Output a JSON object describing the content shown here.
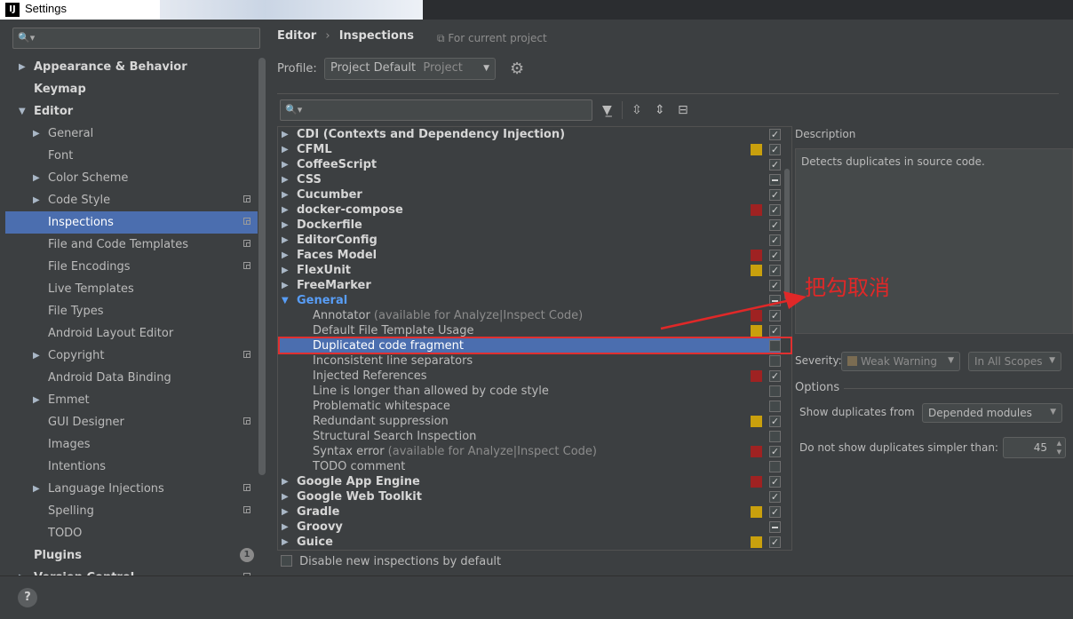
{
  "window": {
    "title": "Settings",
    "app_icon": "IJ"
  },
  "left": {
    "items": [
      {
        "label": "Appearance & Behavior",
        "indent": 0,
        "arrow": "right",
        "bold": true,
        "proj": false
      },
      {
        "label": "Keymap",
        "indent": 0,
        "arrow": "",
        "bold": true,
        "proj": false
      },
      {
        "label": "Editor",
        "indent": 0,
        "arrow": "down",
        "bold": true,
        "proj": false
      },
      {
        "label": "General",
        "indent": 1,
        "arrow": "right",
        "bold": false,
        "proj": false
      },
      {
        "label": "Font",
        "indent": 1,
        "arrow": "",
        "bold": false,
        "proj": false
      },
      {
        "label": "Color Scheme",
        "indent": 1,
        "arrow": "right",
        "bold": false,
        "proj": false
      },
      {
        "label": "Code Style",
        "indent": 1,
        "arrow": "right",
        "bold": false,
        "proj": true
      },
      {
        "label": "Inspections",
        "indent": 1,
        "arrow": "",
        "bold": false,
        "proj": true,
        "selected": true
      },
      {
        "label": "File and Code Templates",
        "indent": 1,
        "arrow": "",
        "bold": false,
        "proj": true
      },
      {
        "label": "File Encodings",
        "indent": 1,
        "arrow": "",
        "bold": false,
        "proj": true
      },
      {
        "label": "Live Templates",
        "indent": 1,
        "arrow": "",
        "bold": false,
        "proj": false
      },
      {
        "label": "File Types",
        "indent": 1,
        "arrow": "",
        "bold": false,
        "proj": false
      },
      {
        "label": "Android Layout Editor",
        "indent": 1,
        "arrow": "",
        "bold": false,
        "proj": false
      },
      {
        "label": "Copyright",
        "indent": 1,
        "arrow": "right",
        "bold": false,
        "proj": true
      },
      {
        "label": "Android Data Binding",
        "indent": 1,
        "arrow": "",
        "bold": false,
        "proj": false
      },
      {
        "label": "Emmet",
        "indent": 1,
        "arrow": "right",
        "bold": false,
        "proj": false
      },
      {
        "label": "GUI Designer",
        "indent": 1,
        "arrow": "",
        "bold": false,
        "proj": true
      },
      {
        "label": "Images",
        "indent": 1,
        "arrow": "",
        "bold": false,
        "proj": false
      },
      {
        "label": "Intentions",
        "indent": 1,
        "arrow": "",
        "bold": false,
        "proj": false
      },
      {
        "label": "Language Injections",
        "indent": 1,
        "arrow": "right",
        "bold": false,
        "proj": true
      },
      {
        "label": "Spelling",
        "indent": 1,
        "arrow": "",
        "bold": false,
        "proj": true
      },
      {
        "label": "TODO",
        "indent": 1,
        "arrow": "",
        "bold": false,
        "proj": false
      },
      {
        "label": "Plugins",
        "indent": 0,
        "arrow": "",
        "bold": true,
        "proj": false,
        "badge": "1"
      },
      {
        "label": "Version Control",
        "indent": 0,
        "arrow": "right",
        "bold": true,
        "proj": true
      }
    ]
  },
  "header": {
    "crumb_1": "Editor",
    "crumb_sep": "›",
    "crumb_2": "Inspections",
    "for_project": "For current project"
  },
  "profile": {
    "label": "Profile:",
    "value": "Project Default",
    "scope": "Project"
  },
  "inspections": [
    {
      "label": "CDI (Contexts and Dependency Injection)",
      "level": 0,
      "arrow": "right",
      "sev": "",
      "check": "on"
    },
    {
      "label": "CFML",
      "level": 0,
      "arrow": "right",
      "sev": "w",
      "check": "on"
    },
    {
      "label": "CoffeeScript",
      "level": 0,
      "arrow": "right",
      "sev": "",
      "check": "on"
    },
    {
      "label": "CSS",
      "level": 0,
      "arrow": "right",
      "sev": "",
      "check": "part"
    },
    {
      "label": "Cucumber",
      "level": 0,
      "arrow": "right",
      "sev": "",
      "check": "on"
    },
    {
      "label": "docker-compose",
      "level": 0,
      "arrow": "right",
      "sev": "e",
      "check": "on"
    },
    {
      "label": "Dockerfile",
      "level": 0,
      "arrow": "right",
      "sev": "",
      "check": "on"
    },
    {
      "label": "EditorConfig",
      "level": 0,
      "arrow": "right",
      "sev": "",
      "check": "on"
    },
    {
      "label": "Faces Model",
      "level": 0,
      "arrow": "right",
      "sev": "e",
      "check": "on"
    },
    {
      "label": "FlexUnit",
      "level": 0,
      "arrow": "right",
      "sev": "w",
      "check": "on"
    },
    {
      "label": "FreeMarker",
      "level": 0,
      "arrow": "right",
      "sev": "",
      "check": "on"
    },
    {
      "label": "General",
      "level": 0,
      "arrow": "down",
      "sev": "",
      "check": "part",
      "hl": true
    },
    {
      "label": "Annotator",
      "note": " (available for Analyze|Inspect Code)",
      "level": 1,
      "arrow": "",
      "sev": "e",
      "check": "on"
    },
    {
      "label": "Default File Template Usage",
      "level": 1,
      "arrow": "",
      "sev": "w",
      "check": "on"
    },
    {
      "label": "Duplicated code fragment",
      "level": 1,
      "arrow": "",
      "sev": "",
      "check": "off",
      "selected": true
    },
    {
      "label": "Inconsistent line separators",
      "level": 1,
      "arrow": "",
      "sev": "",
      "check": "off"
    },
    {
      "label": "Injected References",
      "level": 1,
      "arrow": "",
      "sev": "e",
      "check": "on"
    },
    {
      "label": "Line is longer than allowed by code style",
      "level": 1,
      "arrow": "",
      "sev": "",
      "check": "off"
    },
    {
      "label": "Problematic whitespace",
      "level": 1,
      "arrow": "",
      "sev": "",
      "check": "off"
    },
    {
      "label": "Redundant suppression",
      "level": 1,
      "arrow": "",
      "sev": "w",
      "check": "on"
    },
    {
      "label": "Structural Search Inspection",
      "level": 1,
      "arrow": "",
      "sev": "",
      "check": "off"
    },
    {
      "label": "Syntax error",
      "note": " (available for Analyze|Inspect Code)",
      "level": 1,
      "arrow": "",
      "sev": "e",
      "check": "on"
    },
    {
      "label": "TODO comment",
      "level": 1,
      "arrow": "",
      "sev": "",
      "check": "off"
    },
    {
      "label": "Google App Engine",
      "level": 0,
      "arrow": "right",
      "sev": "e",
      "check": "on"
    },
    {
      "label": "Google Web Toolkit",
      "level": 0,
      "arrow": "right",
      "sev": "",
      "check": "on"
    },
    {
      "label": "Gradle",
      "level": 0,
      "arrow": "right",
      "sev": "w",
      "check": "on"
    },
    {
      "label": "Groovy",
      "level": 0,
      "arrow": "right",
      "sev": "",
      "check": "part"
    },
    {
      "label": "Guice",
      "level": 0,
      "arrow": "right",
      "sev": "w",
      "check": "on"
    }
  ],
  "disable_new": "Disable new inspections by default",
  "description": {
    "label": "Description",
    "text": "Detects duplicates in source code."
  },
  "severity": {
    "label": "Severity:",
    "value": "Weak Warning",
    "scope": "In All Scopes"
  },
  "options": {
    "label": "Options",
    "show_dup_label": "Show duplicates from",
    "show_dup_value": "Depended modules",
    "min_label": "Do not show duplicates simpler than:",
    "min_value": "45"
  },
  "annotation": "把勾取消",
  "colors": {
    "selection": "#4b6eaf",
    "warning": "#c9a00d",
    "error": "#9f2222",
    "annotation": "#e02828"
  }
}
